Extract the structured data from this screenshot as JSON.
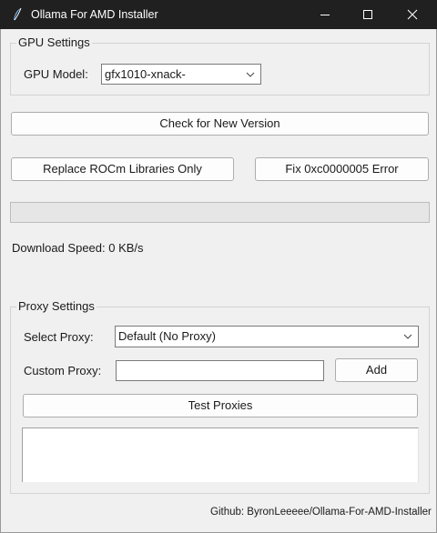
{
  "window": {
    "title": "Ollama For AMD Installer"
  },
  "gpu_settings": {
    "legend": "GPU Settings",
    "model_label": "GPU Model:",
    "model_value": "gfx1010-xnack-"
  },
  "actions": {
    "check_version": "Check for New Version",
    "replace_rocm": "Replace ROCm Libraries Only",
    "fix_error": "Fix 0xc0000005 Error"
  },
  "progress": {
    "value": 0
  },
  "download_speed": "Download Speed: 0 KB/s",
  "proxy_settings": {
    "legend": "Proxy Settings",
    "select_label": "Select Proxy:",
    "select_value": "Default (No Proxy)",
    "custom_label": "Custom Proxy:",
    "custom_value": "",
    "add_label": "Add",
    "test_label": "Test Proxies"
  },
  "footer": "Github: ByronLeeeee/Ollama-For-AMD-Installer",
  "icons": [
    "app-feather-icon",
    "minimize-icon",
    "maximize-icon",
    "close-icon",
    "chevron-down-icon"
  ]
}
